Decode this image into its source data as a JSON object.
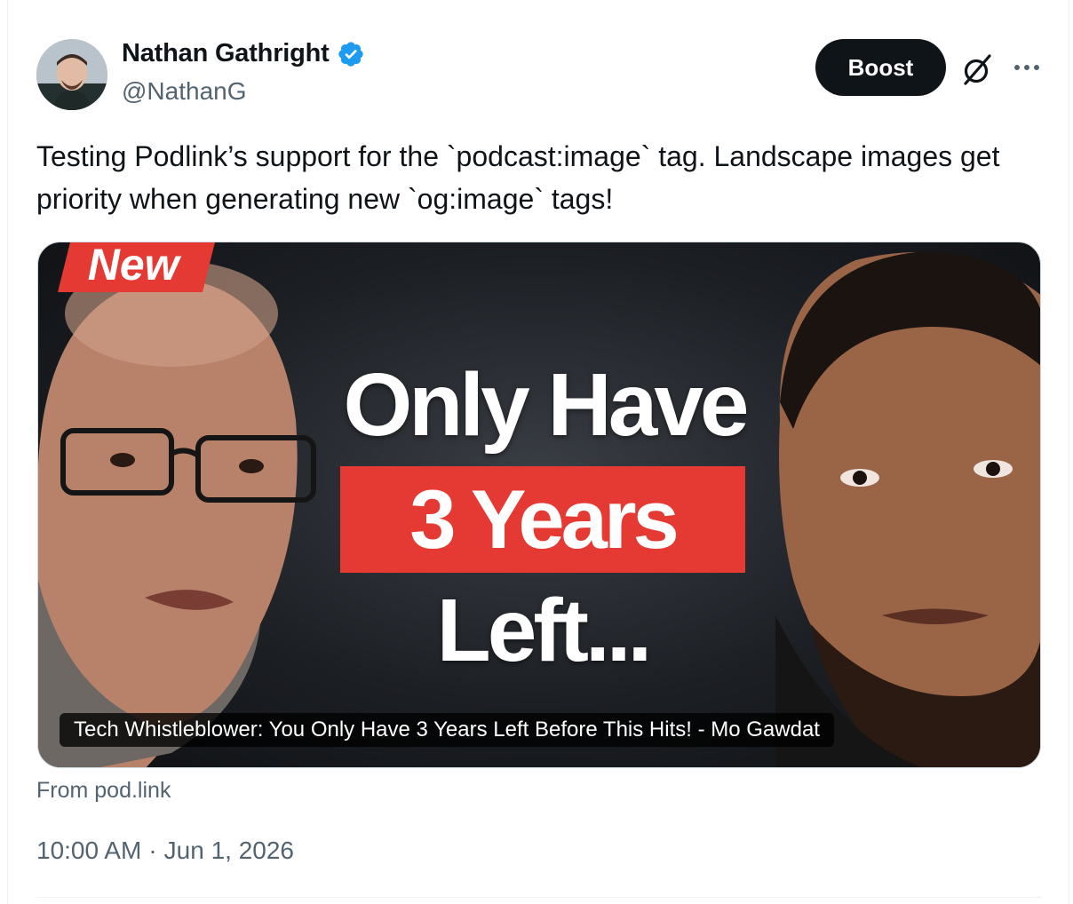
{
  "post": {
    "author": {
      "name": "Nathan Gathright",
      "handle": "@NathanG",
      "verified": true
    },
    "actions": {
      "boost_label": "Boost",
      "grok_icon": "grok-icon",
      "more_icon": "more-icon"
    },
    "text": "Testing Podlink’s support for the `podcast:image` tag. Landscape images get priority when generating new `og:image` tags!",
    "card": {
      "badge": "New",
      "headline_line1": "Only Have",
      "headline_line2": "3 Years",
      "headline_line3": "Left...",
      "caption": "Tech Whistleblower: You Only Have 3 Years Left Before This Hits! - Mo Gawdat",
      "source": "From pod.link"
    },
    "time": "10:00 AM",
    "separator": "·",
    "date": "Jun 1, 2026"
  },
  "colors": {
    "text_primary": "#0f1419",
    "text_secondary": "#536471",
    "verified_blue": "#1d9bf0",
    "accent_red": "#e53a33",
    "button_dark": "#0f1419"
  }
}
